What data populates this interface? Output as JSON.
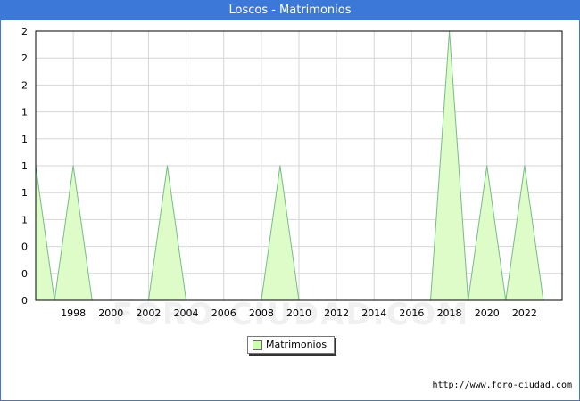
{
  "title": "Loscos - Matrimonios",
  "watermark": "FORO-CIUDAD.COM",
  "source_url": "http://www.foro-ciudad.com",
  "colors": {
    "title_bar": "#3c78d8",
    "area_fill": "#ddfcc8",
    "area_line": "#77bb88",
    "grid": "#d6d6d6"
  },
  "chart_data": {
    "type": "area",
    "title": "Loscos - Matrimonios",
    "xlabel": "",
    "ylabel": "",
    "x": [
      1996,
      1997,
      1998,
      1999,
      2000,
      2001,
      2002,
      2003,
      2004,
      2005,
      2006,
      2007,
      2008,
      2009,
      2010,
      2011,
      2012,
      2013,
      2014,
      2015,
      2016,
      2017,
      2018,
      2019,
      2020,
      2021,
      2022,
      2023
    ],
    "series": [
      {
        "name": "Matrimonios",
        "values": [
          1,
          0,
          1,
          0,
          0,
          0,
          0,
          1,
          0,
          0,
          0,
          0,
          0,
          1,
          0,
          0,
          0,
          0,
          0,
          0,
          0,
          0,
          2,
          0,
          1,
          0,
          1,
          0
        ]
      }
    ],
    "x_ticks": [
      "1998",
      "2000",
      "2002",
      "2004",
      "2006",
      "2008",
      "2010",
      "2012",
      "2014",
      "2016",
      "2018",
      "2020",
      "2022"
    ],
    "y_ticks": [
      "0",
      "0",
      "0",
      "1",
      "1",
      "1",
      "1",
      "1",
      "2",
      "2",
      "2"
    ],
    "xlim": [
      1996,
      2024
    ],
    "ylim": [
      0,
      2
    ],
    "grid": true,
    "legend_position": "bottom-center"
  }
}
